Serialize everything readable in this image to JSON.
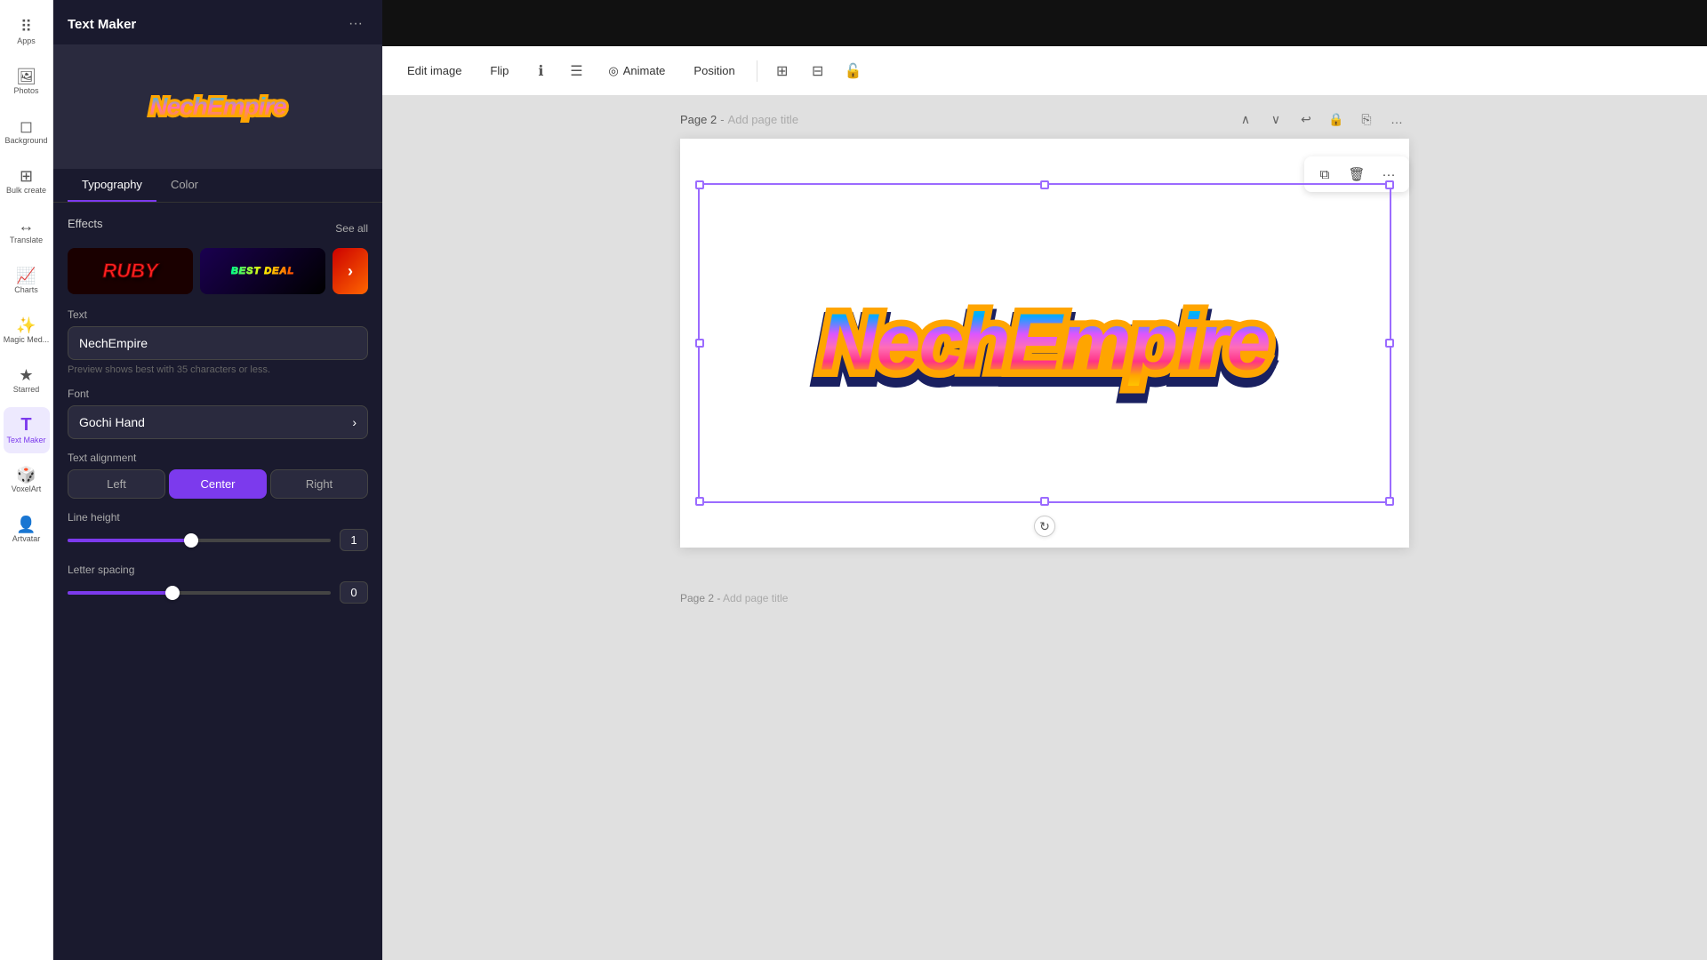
{
  "app": {
    "panel_title": "Text Maker",
    "panel_menu_icon": "···"
  },
  "toolbar": {
    "edit_image": "Edit image",
    "flip": "Flip",
    "animate": "Animate",
    "position": "Position"
  },
  "left_sidebar": {
    "items": [
      {
        "id": "apps",
        "label": "Apps",
        "icon": "⠿"
      },
      {
        "id": "photos",
        "label": "Photos",
        "icon": "🖼"
      },
      {
        "id": "background",
        "label": "Background",
        "icon": "◻"
      },
      {
        "id": "bulk-create",
        "label": "Bulk create",
        "icon": "⊞"
      },
      {
        "id": "translate",
        "label": "Translate",
        "icon": "↔"
      },
      {
        "id": "charts",
        "label": "Charts",
        "icon": "📈"
      },
      {
        "id": "magic-media",
        "label": "Magic Med...",
        "icon": "✨"
      },
      {
        "id": "starred",
        "label": "Starred",
        "icon": "★"
      },
      {
        "id": "text-maker",
        "label": "Text Maker",
        "icon": "T"
      },
      {
        "id": "voxelart",
        "label": "VoxelArt",
        "icon": "🎲"
      },
      {
        "id": "artvatar",
        "label": "Artvatar",
        "icon": "👤"
      }
    ]
  },
  "panel": {
    "tabs": [
      {
        "id": "typography",
        "label": "Typography",
        "active": true
      },
      {
        "id": "color",
        "label": "Color",
        "active": false
      }
    ],
    "effects": {
      "section_label": "Effects",
      "see_all": "See all",
      "items": [
        {
          "id": "ruby",
          "label": "RUBY"
        },
        {
          "id": "bestdeal",
          "label": "BEST DEAL"
        },
        {
          "id": "next",
          "label": "›"
        }
      ]
    },
    "text_section": {
      "label": "Text",
      "value": "NechEmpire",
      "hint": "Preview shows best with 35 characters or less."
    },
    "font_section": {
      "label": "Font",
      "value": "Gochi Hand"
    },
    "alignment_section": {
      "label": "Text alignment",
      "options": [
        {
          "id": "left",
          "label": "Left"
        },
        {
          "id": "center",
          "label": "Center",
          "active": true
        },
        {
          "id": "right",
          "label": "Right"
        }
      ]
    },
    "line_height": {
      "label": "Line height",
      "value": 1,
      "percent": 47
    },
    "letter_spacing": {
      "label": "Letter spacing",
      "value": 0,
      "percent": 40
    }
  },
  "canvas": {
    "page_label": "Page 2",
    "page_title_placeholder": "Add page title",
    "main_text": "NechEmpire"
  },
  "floating_actions": {
    "duplicate": "⧉",
    "delete": "🗑",
    "more": "···"
  }
}
